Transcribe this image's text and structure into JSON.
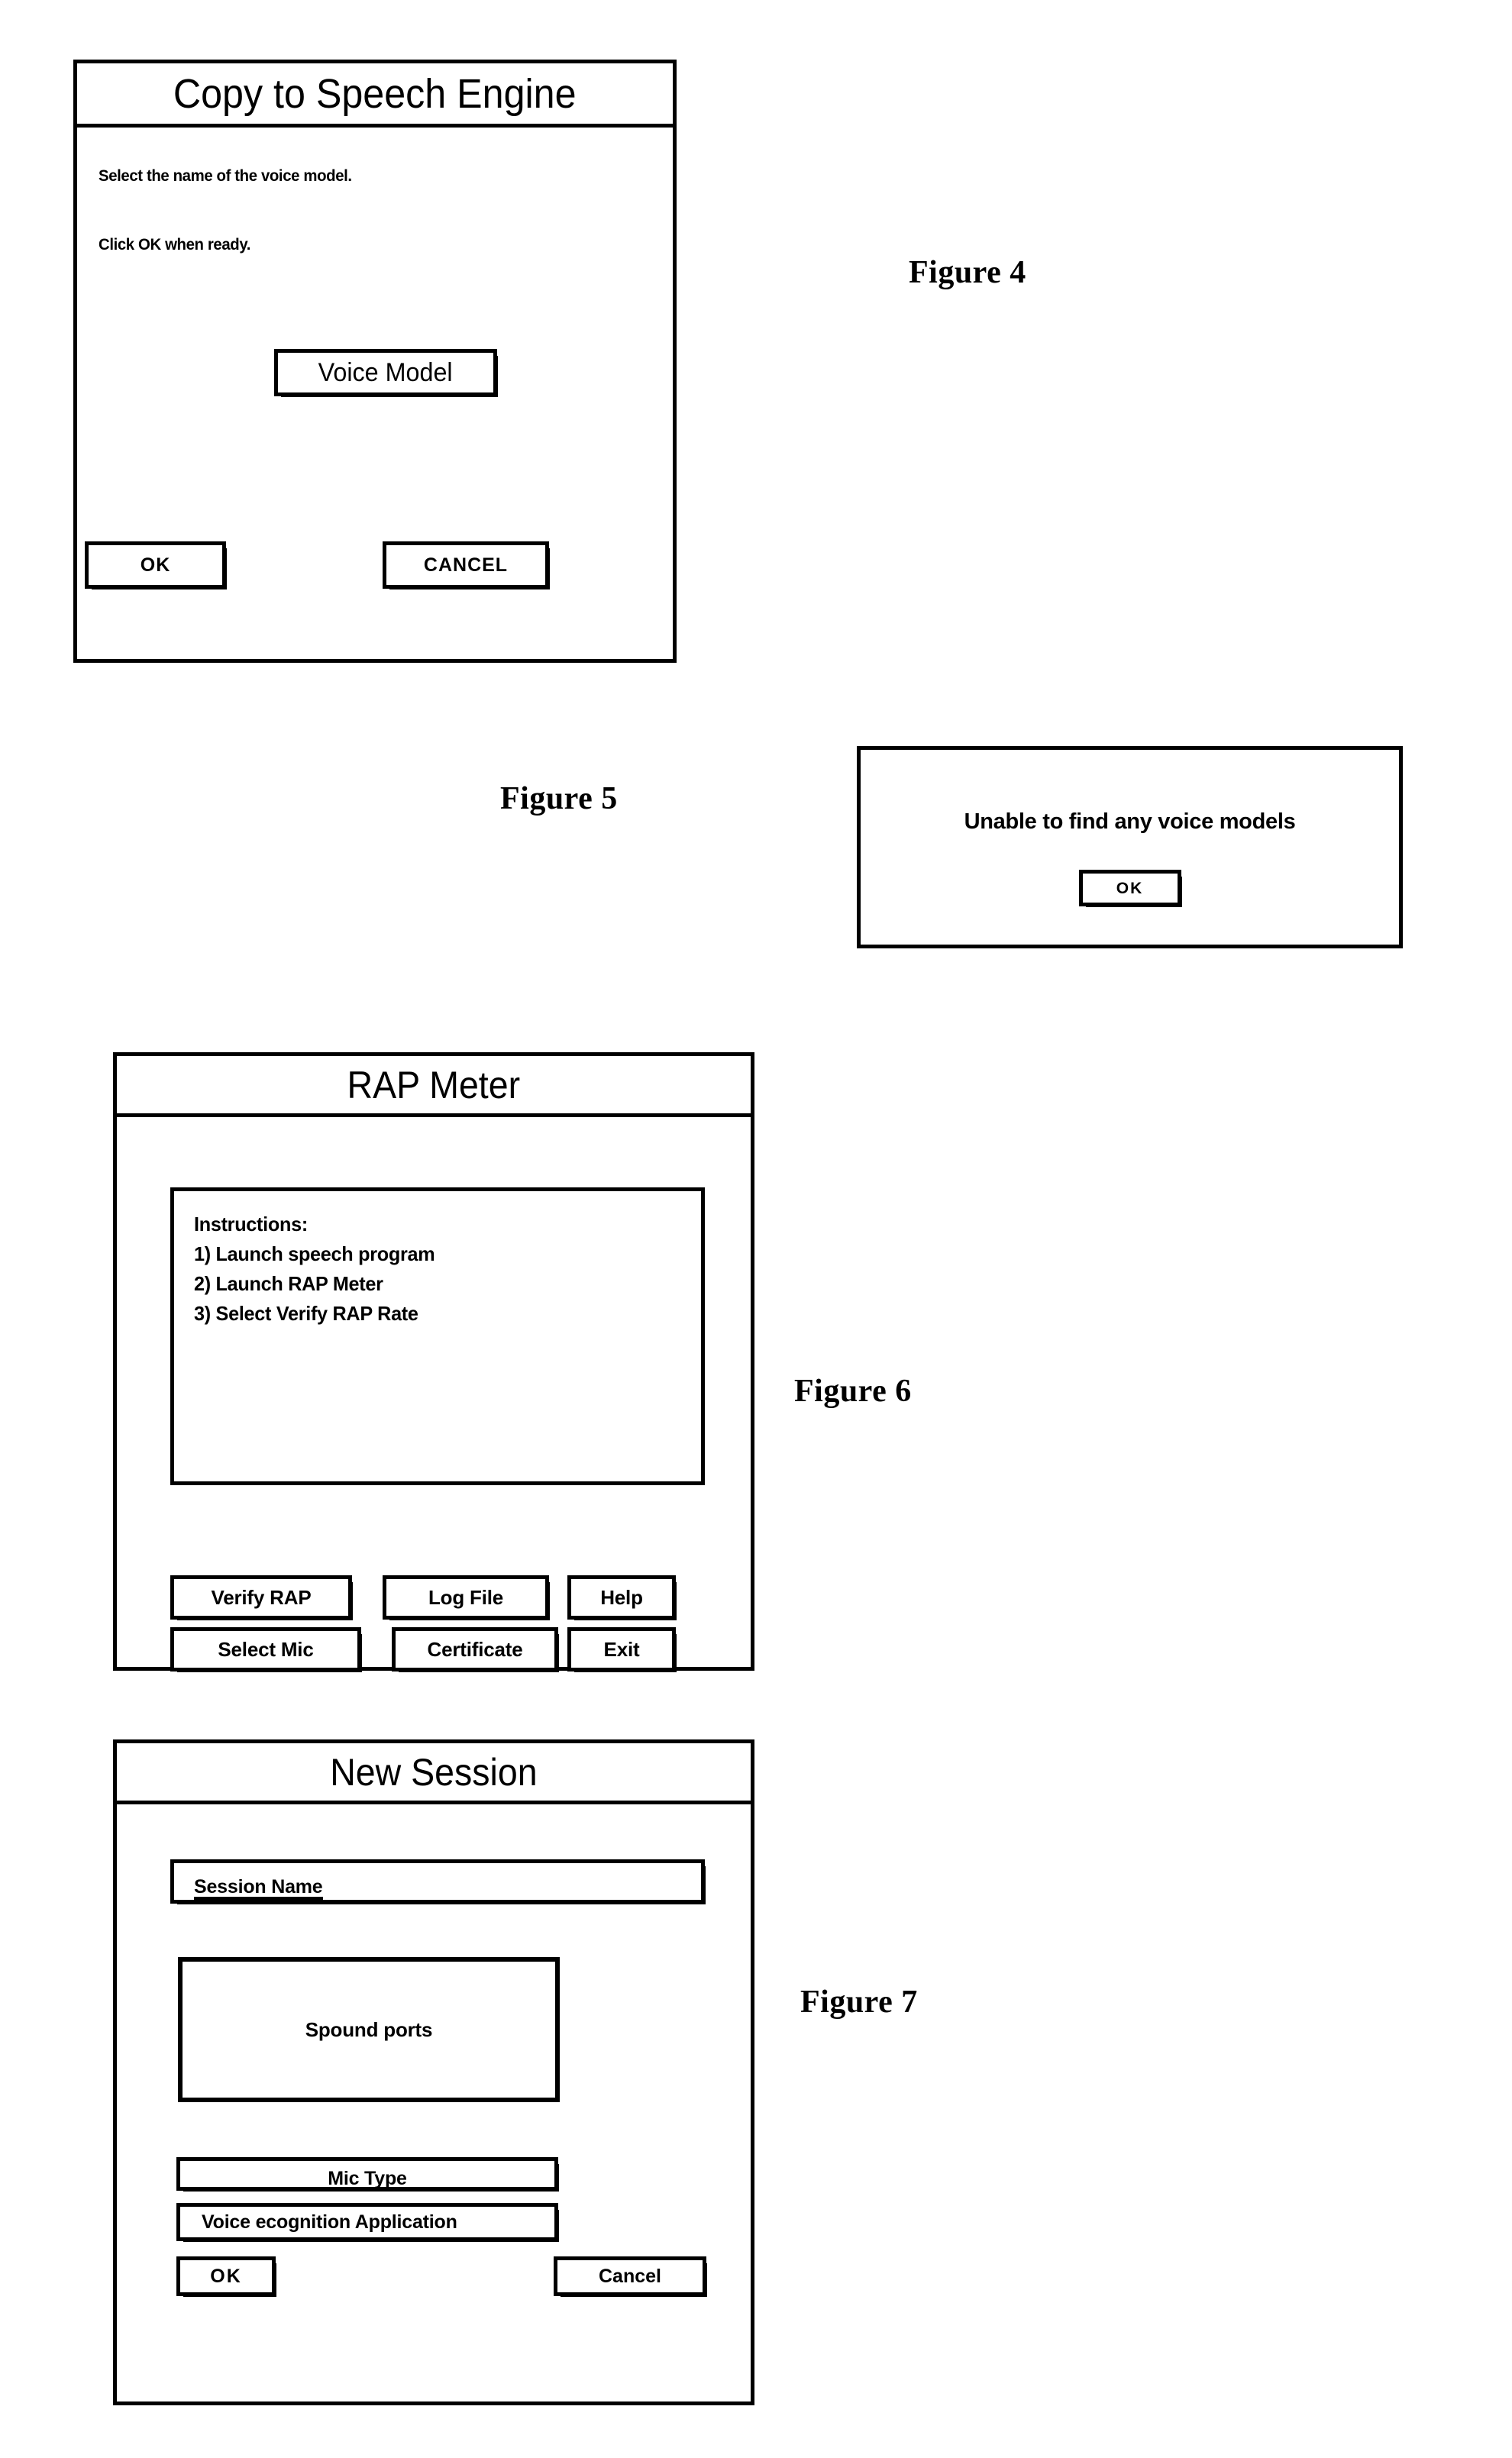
{
  "sheet": {
    "figures": [
      {
        "id": "figure-4",
        "label": "Figure 4",
        "window": {
          "title": "Copy to Speech Engine",
          "body_lines": [
            "Select the name of the voice model.",
            "Click OK when ready."
          ],
          "voice_model_button": "Voice Model",
          "ok_button": "OK",
          "cancel_button": "CANCEL"
        }
      },
      {
        "id": "figure-5",
        "label": "Figure 5",
        "window": {
          "message": "Unable to find any voice models",
          "ok_button": "OK"
        }
      },
      {
        "id": "figure-6",
        "label": "Figure 6",
        "window": {
          "title": "RAP Meter",
          "instructions_heading": "Instructions:",
          "instructions": [
            "1) Launch speech program",
            "2) Launch RAP Meter",
            "3) Select Verify RAP Rate"
          ],
          "buttons_row1": [
            "Verify RAP",
            "Log File",
            "Help"
          ],
          "buttons_row2": [
            "Select Mic",
            "Certificate",
            "Exit"
          ]
        }
      },
      {
        "id": "figure-7",
        "label": "Figure 7",
        "window": {
          "title": "New Session",
          "session_name_field": "Session Name",
          "sound_ports_list": "Spound ports",
          "mic_type_field": "Mic Type",
          "voice_recognition_field": "Voice ecognition Application",
          "ok_button": "OK",
          "cancel_button": "Cancel"
        }
      }
    ]
  },
  "colors": {
    "ink": "#000000",
    "paper": "#ffffff"
  }
}
